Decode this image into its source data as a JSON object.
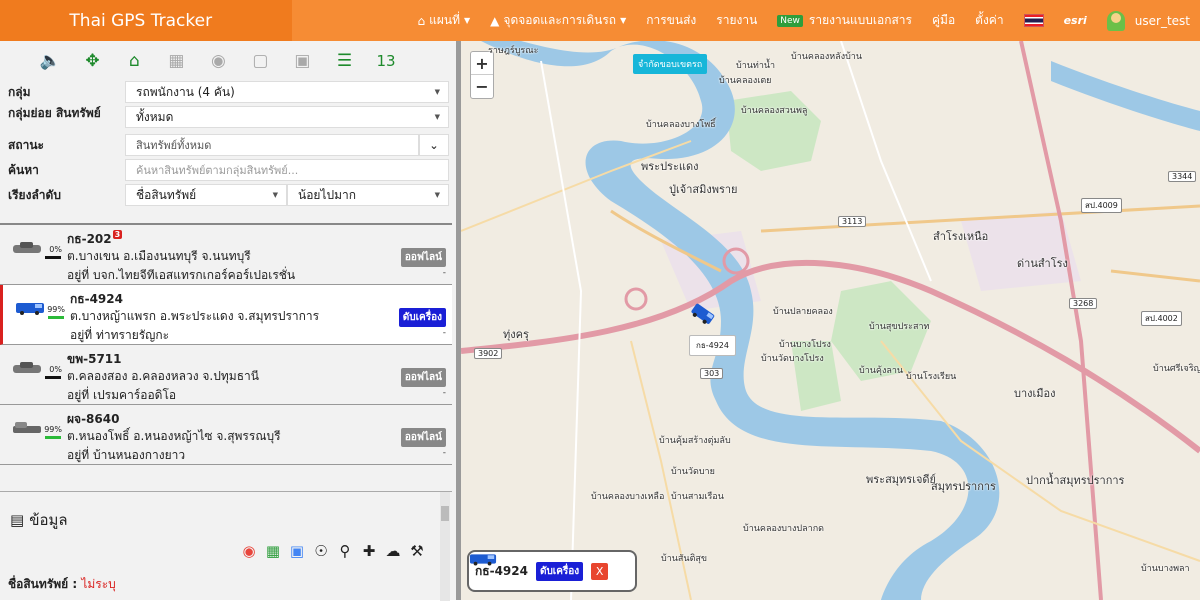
{
  "header": {
    "brand": "Thai GPS Tracker",
    "nav": [
      {
        "label": "แผนที่",
        "icon": "home-icon"
      },
      {
        "label": "จุดจอดและการเดินรถ",
        "icon": "road-icon"
      },
      {
        "label": "การขนส่ง"
      },
      {
        "label": "รายงาน"
      },
      {
        "label": "รายงานแบบเอกสาร",
        "badge": "New"
      },
      {
        "label": "คู่มือ"
      },
      {
        "label": "ตั้งค่า"
      }
    ],
    "esri": "esri",
    "user": "user_test"
  },
  "toolbar": {
    "count": "13"
  },
  "filters": {
    "group_label": "กลุ่ม",
    "group_value": "รถพนักงาน (4 คัน)",
    "subgroup_label": "กลุ่มย่อย สินทรัพย์",
    "subgroup_value": "ทั้งหมด",
    "status_label": "สถานะ",
    "status_value": "สินทรัพย์ทั้งหมด",
    "search_label": "ค้นหา",
    "search_placeholder": "ค้นหาสินทรัพย์ตามกลุ่มสินทรัพย์...",
    "sort_label": "เรียงลำดับ",
    "sort_by": "ชื่อสินทรัพย์",
    "sort_order": "น้อยไปมาก"
  },
  "vehicles": [
    {
      "plate": "กธ-202",
      "alerts": "3",
      "pct": "0%",
      "address": "ต.บางเขน อ.เมืองนนทบุรี จ.นนทบุรี",
      "near": "อยู่ที่ บจก.ไทยจีทีเอสแทรกเกอร์คอร์เปอเรชั่น",
      "status": "ออฟไลน์",
      "dash": "-"
    },
    {
      "plate": "กธ-4924",
      "alerts": "",
      "pct": "99%",
      "address": "ต.บางหญ้าแพรก อ.พระประแดง จ.สมุทรปราการ",
      "near": "อยู่ที่ ท่าทรายรัญกะ",
      "status": "ดับเครื่อง",
      "dash": "-"
    },
    {
      "plate": "ขพ-5711",
      "alerts": "",
      "pct": "0%",
      "address": "ต.คลองสอง อ.คลองหลวง จ.ปทุมธานี",
      "near": "อยู่ที่ เปรมคาร์ออดิโอ",
      "status": "ออฟไลน์",
      "dash": "-"
    },
    {
      "plate": "ผจ-8640",
      "alerts": "",
      "pct": "99%",
      "address": "ต.หนองโพธิ์ อ.หนองหญ้าไซ จ.สุพรรณบุรี",
      "near": "อยู่ที่ บ้านหนองกางยาว",
      "status": "ออฟไลน์",
      "dash": "-"
    }
  ],
  "info": {
    "title": "ข้อมูล",
    "name_label": "ชื่อสินทรัพย์ :",
    "name_value": "ไม่ระบุ"
  },
  "map": {
    "route_chip": "จำกัดขอบเขตรถ",
    "truck_label": "กธ-4924",
    "popup_plate": "กธ-4924",
    "popup_status": "ดับเครื่อง",
    "popup_close": "X",
    "labels": [
      "ราษฎร์บูรณะ",
      "บ้านท่าน้ำ",
      "บ้านคลองหลังบ้าน",
      "บ้านคลองเตย",
      "บ้านคลองสวนพลู",
      "บ้านคลองบางโพธิ์",
      "พระประแดง",
      "ปู่เจ้าสมิงพราย",
      "สำโรงเหนือ",
      "ด่านสำโรง",
      "ทุ่งครุ",
      "บ้านปลายคลอง",
      "บ้านสุขประสาท",
      "บ้านบางโปรง",
      "บ้านวัดบางโปรง",
      "บ้านคุ้งลาน",
      "บ้านโรงเรียน",
      "บางเมือง",
      "พระสมุทรเจดีย์",
      "สมุทรปราการ",
      "ปากน้ำสมุทรปราการ",
      "บ้านคลองบางเหลือ",
      "บ้านสามเรือน",
      "บ้านวัดบาย",
      "บ้านคุ้มสร้างตุ่มลับ",
      "บ้านคลองบางปลากด",
      "บ้านสันติสุข",
      "บ้านศรีเจริญ",
      "บ้านบางพลา"
    ],
    "roads": [
      "3113",
      "3268",
      "3902",
      "303",
      "3344",
      "สป.4009",
      "สป.4002"
    ]
  }
}
